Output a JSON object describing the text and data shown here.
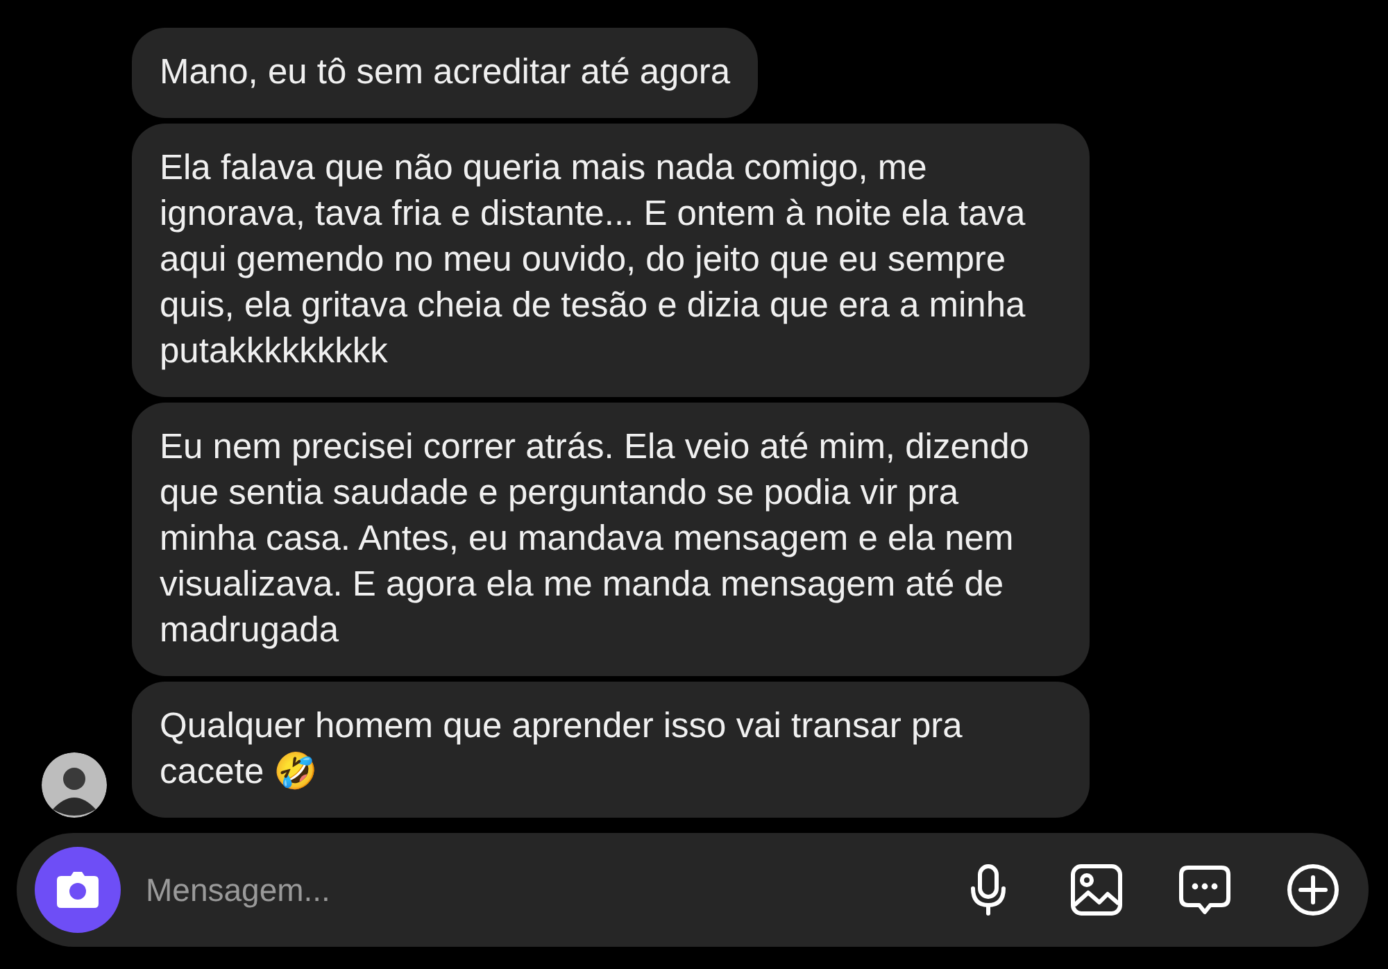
{
  "messages": [
    {
      "text": "Mano, eu tô sem acreditar até agora"
    },
    {
      "text": "Ela falava que não queria mais nada comigo, me ignorava, tava fria e distante... E ontem à noite ela tava aqui gemendo no meu ouvido, do jeito que eu sempre quis, ela gritava cheia de tesão e dizia que era a minha putakkkkkkkkk"
    },
    {
      "text": "Eu nem precisei correr atrás. Ela veio até mim, dizendo que sentia saudade e perguntando se podia vir pra minha casa. Antes, eu mandava mensagem e ela nem visualizava. E agora ela me manda mensagem até de madrugada"
    },
    {
      "text": "Qualquer homem que aprender isso vai transar pra cacete 🤣"
    }
  ],
  "composer": {
    "placeholder": "Mensagem..."
  }
}
